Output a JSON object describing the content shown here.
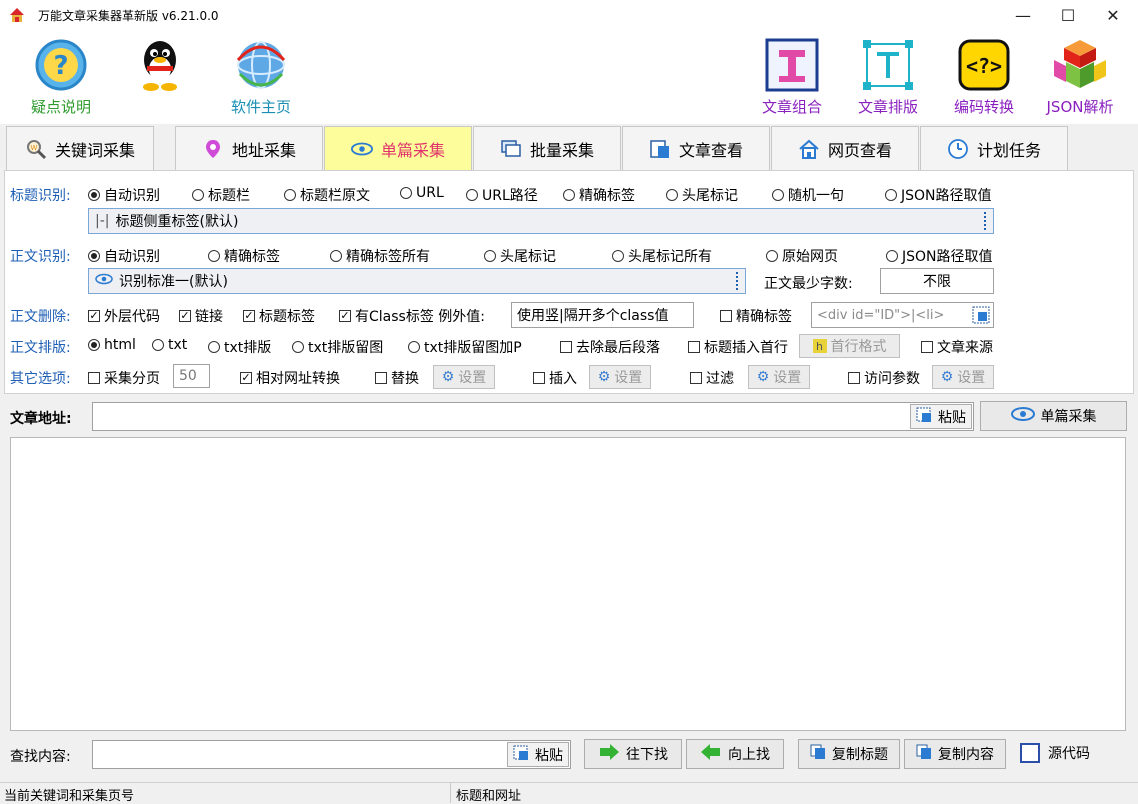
{
  "window": {
    "title": "万能文章采集器革新版 v6.21.0.0",
    "minimize": "—",
    "maximize": "☐",
    "close": "✕"
  },
  "toolbar": {
    "left": [
      {
        "label": "疑点说明",
        "icon": "question-icon"
      },
      {
        "label": "",
        "icon": "qq-penguin-icon"
      },
      {
        "label": "软件主页",
        "icon": "globe-icon"
      }
    ],
    "right": [
      {
        "label": "文章组合",
        "icon": "text-combine-icon"
      },
      {
        "label": "文章排版",
        "icon": "text-format-icon"
      },
      {
        "label": "编码转换",
        "icon": "code-convert-icon"
      },
      {
        "label": "JSON解析",
        "icon": "cubes-icon"
      }
    ]
  },
  "tabs": [
    {
      "label": "关键词采集",
      "icon": "keyword-search-icon"
    },
    {
      "label": "地址采集",
      "icon": "location-pin-icon"
    },
    {
      "label": "单篇采集",
      "icon": "eye-icon",
      "active": true
    },
    {
      "label": "批量采集",
      "icon": "batch-windows-icon"
    },
    {
      "label": "文章查看",
      "icon": "article-view-icon"
    },
    {
      "label": "网页查看",
      "icon": "home-icon"
    },
    {
      "label": "计划任务",
      "icon": "clock-icon"
    }
  ],
  "title_recognition": {
    "label": "标题识别:",
    "options": [
      "自动识别",
      "标题栏",
      "标题栏原文",
      "URL",
      "URL路径",
      "精确标签",
      "头尾标记",
      "随机一句",
      "JSON路径取值"
    ],
    "selected": "自动识别",
    "combo_value": "标题侧重标签(默认)"
  },
  "body_recognition": {
    "label": "正文识别:",
    "options": [
      "自动识别",
      "精确标签",
      "精确标签所有",
      "头尾标记",
      "头尾标记所有",
      "原始网页",
      "JSON路径取值"
    ],
    "selected": "自动识别",
    "combo_value": "识别标准一(默认)",
    "min_chars_label": "正文最少字数:",
    "min_chars_value": "不限"
  },
  "body_delete": {
    "label": "正文删除:",
    "checks": [
      {
        "label": "外层代码",
        "checked": true
      },
      {
        "label": "链接",
        "checked": true
      },
      {
        "label": "标题标签",
        "checked": true
      },
      {
        "label": "有Class标签 例外值:",
        "checked": true
      }
    ],
    "exception_value": "使用竖|隔开多个class值",
    "exact_tag_label": "精确标签",
    "exact_tag_placeholder": "<div id=\"ID\">|<li>"
  },
  "body_format": {
    "label": "正文排版:",
    "options": [
      "html",
      "txt",
      "txt排版",
      "txt排版留图",
      "txt排版留图加P"
    ],
    "selected": "html",
    "remove_last": "去除最后段落",
    "insert_title": "标题插入首行",
    "first_line_btn": "首行格式",
    "article_source": "文章来源"
  },
  "other_options": {
    "label": "其它选项:",
    "paging": "采集分页",
    "paging_value": "50",
    "relative_url": "相对网址转换",
    "replace": "替换",
    "insert": "插入",
    "filter": "过滤",
    "visit_params": "访问参数",
    "settings_label": "设置"
  },
  "url_row": {
    "label": "文章地址:",
    "value": "",
    "paste": "粘贴",
    "collect": "单篇采集"
  },
  "find_row": {
    "label": "查找内容:",
    "value": "",
    "paste": "粘贴",
    "find_next": "往下找",
    "find_prev": "向上找",
    "copy_title": "复制标题",
    "copy_content": "复制内容",
    "source_code": "源代码"
  },
  "status": {
    "left": "当前关键词和采集页号",
    "right": "标题和网址"
  },
  "colors": {
    "active_tab_bg": "#fefd9b",
    "active_tab_text": "#e0336b",
    "label_blue": "#1e5fb5"
  }
}
